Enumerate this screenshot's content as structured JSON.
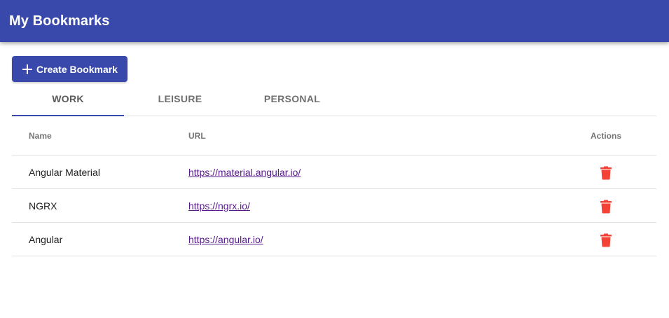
{
  "toolbar": {
    "title": "My Bookmarks",
    "color": "#3949ab"
  },
  "actions": {
    "create_label": "Create Bookmark",
    "create_icon": "plus-icon"
  },
  "tabs": [
    {
      "label": "WORK",
      "active": true
    },
    {
      "label": "LEISURE",
      "active": false
    },
    {
      "label": "PERSONAL",
      "active": false
    }
  ],
  "table": {
    "headers": {
      "name": "Name",
      "url": "URL",
      "actions": "Actions"
    },
    "rows": [
      {
        "name": "Angular Material",
        "url": "https://material.angular.io/",
        "action_icon": "trash-icon"
      },
      {
        "name": "NGRX",
        "url": "https://ngrx.io/",
        "action_icon": "trash-icon"
      },
      {
        "name": "Angular",
        "url": "https://angular.io/",
        "action_icon": "trash-icon"
      }
    ]
  },
  "colors": {
    "primary": "#3949ab",
    "delete": "#f44336",
    "link": "#551a8b"
  }
}
